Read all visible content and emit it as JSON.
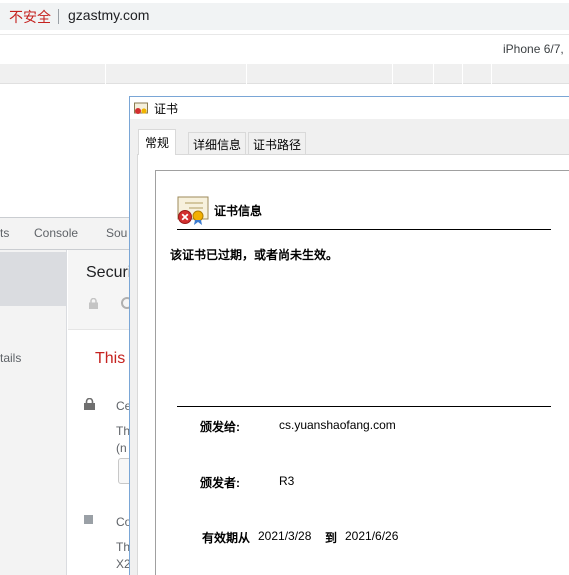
{
  "browser": {
    "security_label": "不安全",
    "url": "gzastmy.com",
    "device": "iPhone 6/7,"
  },
  "devtools": {
    "tabs": [
      "ts",
      "Console",
      "Sou"
    ],
    "sidebar_partial": "tails",
    "heading_partial": "Securi",
    "warning_partial": "This",
    "row1_label": "Ce",
    "row1_text1": "Th",
    "row1_text2": "(n",
    "row2_label": "Co",
    "row2_text1": "Th",
    "row2_text2": "X2"
  },
  "dialog": {
    "title": "证书",
    "tabs": [
      "常规",
      "详细信息",
      "证书路径"
    ],
    "info_title": "证书信息",
    "status": "该证书已过期，或者尚未生效。",
    "issued_to_label": "颁发给:",
    "issued_to": "cs.yuanshaofang.com",
    "issued_by_label": "颁发者:",
    "issued_by": "R3",
    "valid_from_label": "有效期从",
    "valid_from": "2021/3/28",
    "valid_to_label": "到",
    "valid_to": "2021/6/26"
  },
  "colors": {
    "insecure": "#c5221f",
    "dialog_border": "#7aa6d6",
    "warning": "#c5221f"
  }
}
